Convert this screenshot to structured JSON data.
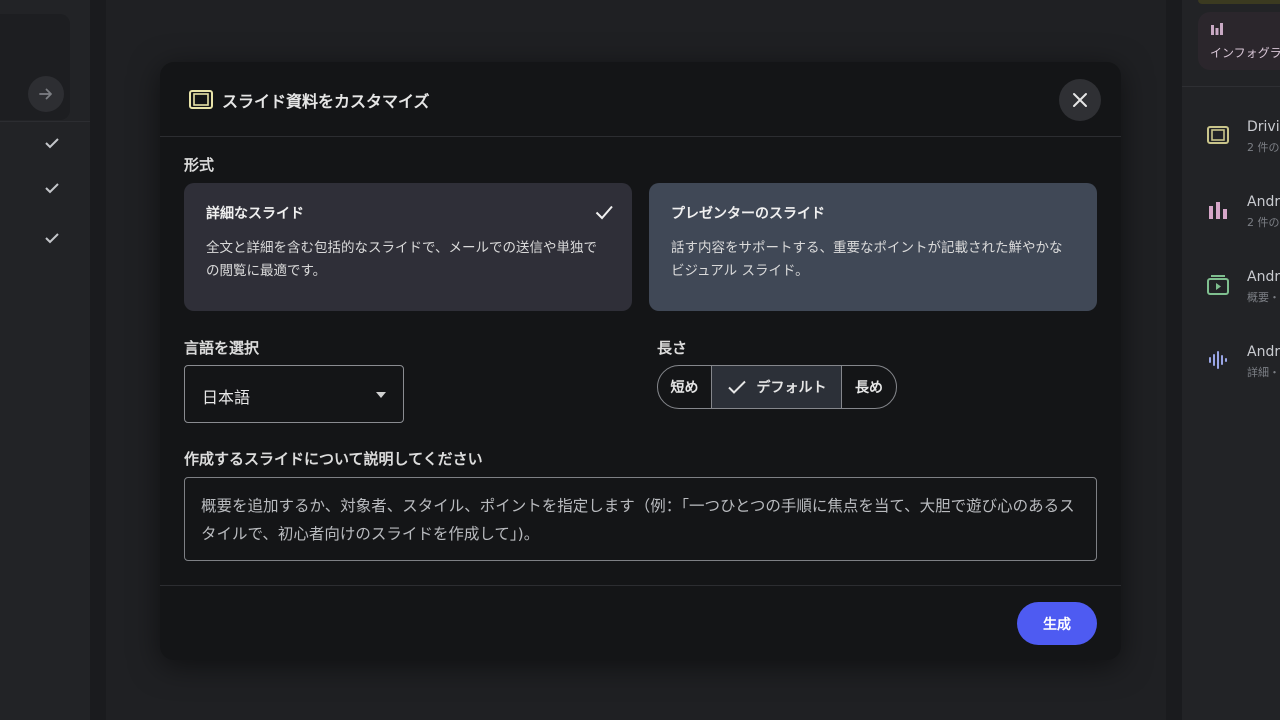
{
  "modal": {
    "title": "スライド資料をカスタマイズ",
    "format_label": "形式",
    "formats": [
      {
        "title": "詳細なスライド",
        "description": "全文と詳細を含む包括的なスライドで、メールでの送信や単独での閲覧に最適です。",
        "selected": true
      },
      {
        "title": "プレゼンターのスライド",
        "description": "話す内容をサポートする、重要なポイントが記載された鮮やかなビジュアル スライド。",
        "selected": false
      }
    ],
    "language_label": "言語を選択",
    "language_value": "日本語",
    "length_label": "長さ",
    "length_options": [
      "短め",
      "デフォルト",
      "長め"
    ],
    "length_selected": "デフォルト",
    "description_label": "作成するスライドについて説明してください",
    "description_placeholder": "概要を追加するか、対象者、スタイル、ポイントを指定します（例：「一つひとつの手順に焦点を当て、大胆で遊び心のあるスタイルで、初心者向けのスライドを作成して」)。",
    "generate_label": "生成"
  },
  "right_panel": {
    "top_card_label": "インフォグラ",
    "artifacts": [
      {
        "title": "Drivi",
        "sub": "2 件の",
        "icon": "slides-icon",
        "color": "#c9c48a"
      },
      {
        "title": "Andr",
        "sub": "2 件の",
        "icon": "infographic-icon",
        "color": "#d6a6c8"
      },
      {
        "title": "Andr",
        "sub": "概要・",
        "icon": "video-icon",
        "color": "#7fbf8f"
      },
      {
        "title": "Andr",
        "sub": "詳細・",
        "icon": "audio-icon",
        "color": "#9aa6e6"
      }
    ]
  },
  "colors": {
    "accent": "#4e5bf2",
    "selected_card": "#2f2f38",
    "unselected_card": "#404856"
  }
}
